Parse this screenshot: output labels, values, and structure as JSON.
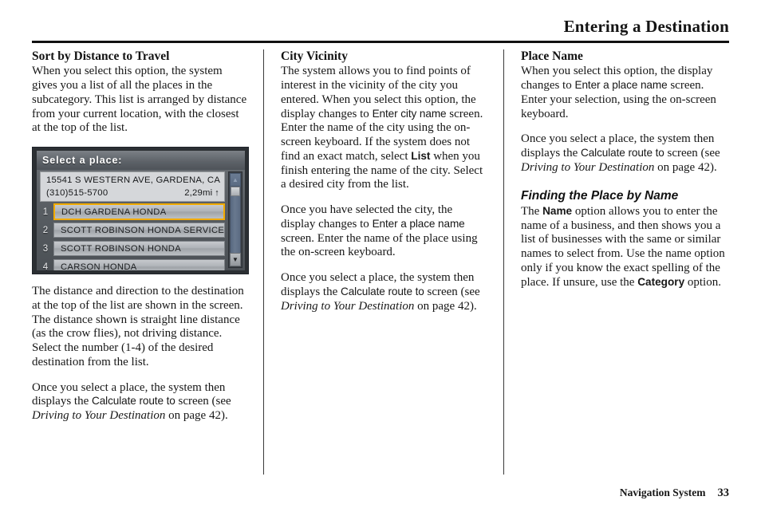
{
  "header": {
    "title": "Entering a Destination"
  },
  "footer": {
    "book_title": "Navigation System",
    "page_number": "33"
  },
  "columns": {
    "col1": {
      "heading": "Sort by Distance to Travel",
      "para1": "When you select this option, the system gives you a list of all the places in the subcategory. This list is arranged by distance from your current location, with the closest at the top of the list.",
      "para2": "The distance and direction to the destination at the top of the list are shown in the screen. The distance shown is straight line distance (as the crow flies), not driving distance. Select the number (1-4) of the desired destination from the list.",
      "para3_a": "Once you select a place, the system then displays the ",
      "para3_ui": "Calculate route to",
      "para3_b": " screen (see ",
      "para3_ital": "Driving to Your Destination",
      "para3_c": " on page 42)."
    },
    "col2": {
      "heading": "City Vicinity",
      "para1_a": "The system allows you to find points of interest in the vicinity of the city you entered. When you select this option, the display changes to ",
      "para1_ui": "Enter city name",
      "para1_b": " screen. Enter the name of the city using the on-screen keyboard. If the system does not find an exact match, select ",
      "para1_ui2": "List",
      "para1_c": " when you finish entering the name of the city. Select a desired city from the list.",
      "para2_a": "Once you have selected the city, the display changes to ",
      "para2_ui": "Enter a place name",
      "para2_b": " screen. Enter the name of the place using the on-screen keyboard.",
      "para3_a": "Once you select a place, the system then displays the ",
      "para3_ui": "Calculate route to",
      "para3_b": " screen (see ",
      "para3_ital": "Driving to Your Destination",
      "para3_c": " on page 42)."
    },
    "col3": {
      "heading": "Place Name",
      "para1_a": "When you select this option, the display changes to ",
      "para1_ui": "Enter a place name",
      "para1_b": " screen. Enter your selection, using the on-screen keyboard.",
      "para2_a": "Once you select a place, the system then displays the ",
      "para2_ui": "Calculate route to",
      "para2_b": " screen (see ",
      "para2_ital": "Driving to Your Destination",
      "para2_c": " on page 42).",
      "heading2": "Finding the Place by Name",
      "para3_a": "The ",
      "para3_ui": "Name",
      "para3_b": " option allows you to enter the name of a business, and then shows you a list of businesses with the same or similar names to select from. Use the name option only if you know the exact spelling of the place. If unsure, use the ",
      "para3_ui2": "Category",
      "para3_c": " option."
    }
  },
  "nav_screenshot": {
    "title": "Select a place:",
    "address_line1": "15541 S WESTERN AVE, GARDENA, CA",
    "phone": "(310)515-5700",
    "distance": "2,29mi",
    "direction_arrow": "↑",
    "scrollbar": {
      "up_arrow": "▲",
      "down_arrow": "▼"
    },
    "list": [
      {
        "num": "1",
        "label": "DCH GARDENA HONDA",
        "selected": true
      },
      {
        "num": "2",
        "label": "SCOTT ROBINSON HONDA SERVICE CE",
        "selected": false
      },
      {
        "num": "3",
        "label": "SCOTT ROBINSON HONDA",
        "selected": false
      },
      {
        "num": "4",
        "label": "CARSON HONDA",
        "selected": false
      }
    ]
  },
  "colors": {
    "selection_highlight": "#f2ab00",
    "rule": "#111111"
  }
}
